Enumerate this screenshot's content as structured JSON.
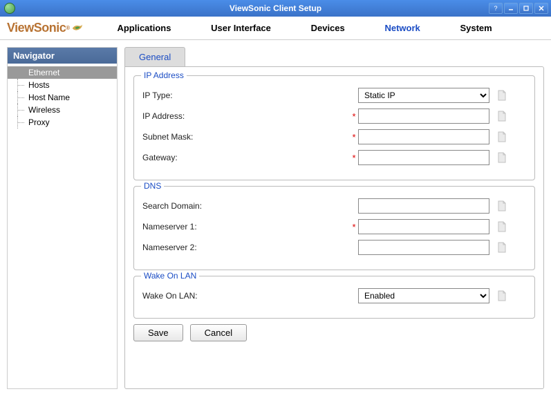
{
  "window": {
    "title": "ViewSonic Client Setup"
  },
  "brand": {
    "name": "ViewSonic",
    "registered": "®"
  },
  "topnav": {
    "items": [
      {
        "label": "Applications",
        "active": false
      },
      {
        "label": "User Interface",
        "active": false
      },
      {
        "label": "Devices",
        "active": false
      },
      {
        "label": "Network",
        "active": true
      },
      {
        "label": "System",
        "active": false
      }
    ]
  },
  "sidebar": {
    "header": "Navigator",
    "items": [
      {
        "label": "Ethernet",
        "selected": true
      },
      {
        "label": "Hosts",
        "selected": false
      },
      {
        "label": "Host Name",
        "selected": false
      },
      {
        "label": "Wireless",
        "selected": false
      },
      {
        "label": "Proxy",
        "selected": false
      }
    ]
  },
  "tabs": {
    "general": "General"
  },
  "groups": {
    "ip": {
      "legend": "IP Address",
      "fields": {
        "iptype": {
          "label": "IP Type:",
          "value": "Static IP",
          "required": false
        },
        "ipaddress": {
          "label": "IP Address:",
          "value": "",
          "required": true
        },
        "subnet": {
          "label": "Subnet Mask:",
          "value": "",
          "required": true
        },
        "gateway": {
          "label": "Gateway:",
          "value": "",
          "required": true
        }
      }
    },
    "dns": {
      "legend": "DNS",
      "fields": {
        "domain": {
          "label": "Search Domain:",
          "value": "",
          "required": false
        },
        "ns1": {
          "label": "Nameserver 1:",
          "value": "",
          "required": true
        },
        "ns2": {
          "label": "Nameserver 2:",
          "value": "",
          "required": false
        }
      }
    },
    "wol": {
      "legend": "Wake On LAN",
      "fields": {
        "wol": {
          "label": "Wake On LAN:",
          "value": "Enabled",
          "required": false
        }
      }
    }
  },
  "buttons": {
    "save": "Save",
    "cancel": "Cancel"
  }
}
